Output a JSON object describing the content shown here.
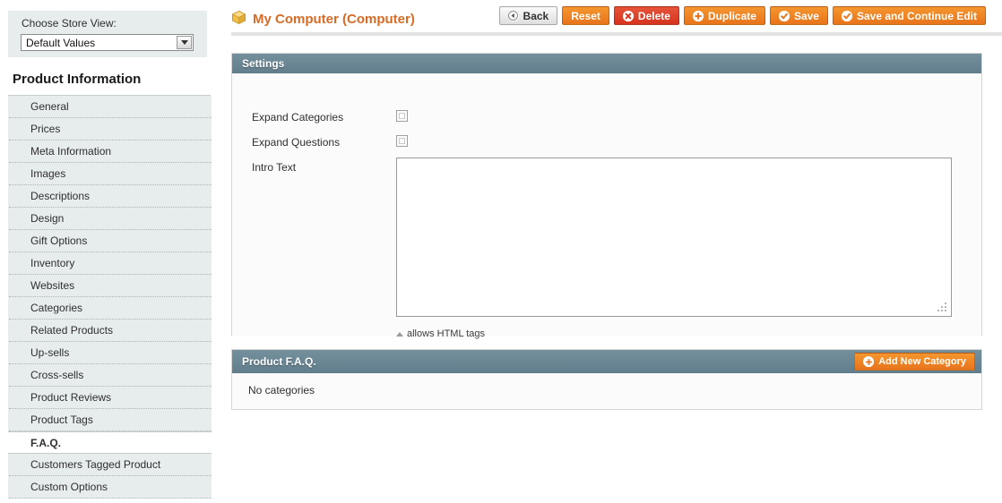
{
  "store_view": {
    "label": "Choose Store View:",
    "selected": "Default Values",
    "options": [
      "Default Values"
    ]
  },
  "sidebar": {
    "title": "Product Information",
    "items": [
      {
        "label": "General",
        "active": false
      },
      {
        "label": "Prices",
        "active": false
      },
      {
        "label": "Meta Information",
        "active": false
      },
      {
        "label": "Images",
        "active": false
      },
      {
        "label": "Descriptions",
        "active": false
      },
      {
        "label": "Design",
        "active": false
      },
      {
        "label": "Gift Options",
        "active": false
      },
      {
        "label": "Inventory",
        "active": false
      },
      {
        "label": "Websites",
        "active": false
      },
      {
        "label": "Categories",
        "active": false
      },
      {
        "label": "Related Products",
        "active": false
      },
      {
        "label": "Up-sells",
        "active": false
      },
      {
        "label": "Cross-sells",
        "active": false
      },
      {
        "label": "Product Reviews",
        "active": false
      },
      {
        "label": "Product Tags",
        "active": false
      },
      {
        "label": "F.A.Q.",
        "active": true
      },
      {
        "label": "Customers Tagged Product",
        "active": false
      },
      {
        "label": "Custom Options",
        "active": false
      }
    ]
  },
  "header": {
    "title": "My Computer (Computer)",
    "title_icon": "product-box-icon",
    "title_color": "#d66b26",
    "buttons": [
      {
        "label": "Back",
        "icon": "back-arrow-circle-icon",
        "style": "grey"
      },
      {
        "label": "Reset",
        "icon": "",
        "style": "orange"
      },
      {
        "label": "Delete",
        "icon": "delete-x-circle-icon",
        "style": "red"
      },
      {
        "label": "Duplicate",
        "icon": "plus-circle-icon",
        "style": "orange"
      },
      {
        "label": "Save",
        "icon": "check-circle-icon",
        "style": "orange"
      },
      {
        "label": "Save and Continue Edit",
        "icon": "check-circle-icon",
        "style": "orange"
      }
    ]
  },
  "settings_panel": {
    "title": "Settings",
    "fields": {
      "expand_categories_label": "Expand Categories",
      "expand_categories_checked": false,
      "expand_questions_label": "Expand Questions",
      "expand_questions_checked": false,
      "intro_text_label": "Intro Text",
      "intro_text_value": "",
      "intro_text_note": "allows HTML tags"
    }
  },
  "faq_panel": {
    "title": "Product F.A.Q.",
    "add_button_label": "Add New Category",
    "add_button_icon": "plus-circle-icon",
    "empty_message": "No categories"
  },
  "colors": {
    "accent_orange": "#e8741c",
    "panel_header_slate": "#6a8593",
    "delete_red": "#d6331c",
    "sidebar_bg": "#e7ecec"
  }
}
